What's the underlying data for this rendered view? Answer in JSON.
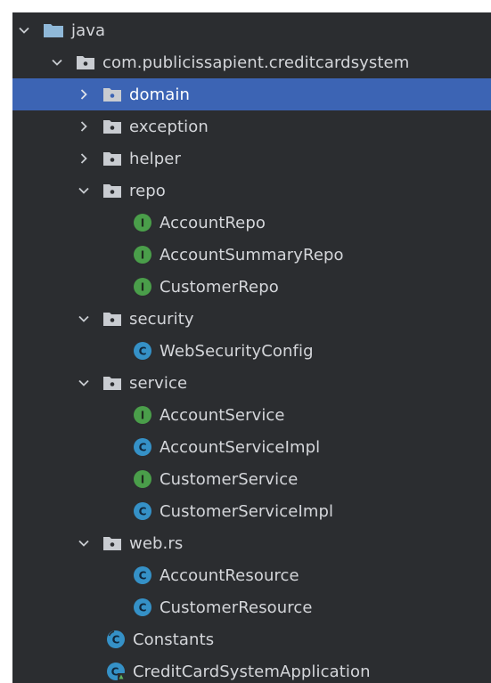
{
  "tree": {
    "root": {
      "label": "java",
      "expanded": true,
      "icon": "source-root-folder-icon"
    },
    "package": {
      "label": "com.publicissapient.creditcardsystem",
      "expanded": true,
      "icon": "package-folder-icon"
    },
    "folders": [
      {
        "key": "domain",
        "label": "domain",
        "expanded": false,
        "selected": true,
        "icon": "package-folder-icon",
        "children": []
      },
      {
        "key": "exception",
        "label": "exception",
        "expanded": false,
        "selected": false,
        "icon": "package-folder-icon",
        "children": []
      },
      {
        "key": "helper",
        "label": "helper",
        "expanded": false,
        "selected": false,
        "icon": "package-folder-icon",
        "children": []
      },
      {
        "key": "repo",
        "label": "repo",
        "expanded": true,
        "selected": false,
        "icon": "package-folder-icon",
        "children": [
          {
            "label": "AccountRepo",
            "kind": "interface",
            "icon": "interface-icon"
          },
          {
            "label": "AccountSummaryRepo",
            "kind": "interface",
            "icon": "interface-icon"
          },
          {
            "label": "CustomerRepo",
            "kind": "interface",
            "icon": "interface-icon"
          }
        ]
      },
      {
        "key": "security",
        "label": "security",
        "expanded": true,
        "selected": false,
        "icon": "package-folder-icon",
        "children": [
          {
            "label": "WebSecurityConfig",
            "kind": "class",
            "icon": "class-icon"
          }
        ]
      },
      {
        "key": "service",
        "label": "service",
        "expanded": true,
        "selected": false,
        "icon": "package-folder-icon",
        "children": [
          {
            "label": "AccountService",
            "kind": "interface",
            "icon": "interface-icon"
          },
          {
            "label": "AccountServiceImpl",
            "kind": "class",
            "icon": "class-icon"
          },
          {
            "label": "CustomerService",
            "kind": "interface",
            "icon": "interface-icon"
          },
          {
            "label": "CustomerServiceImpl",
            "kind": "class",
            "icon": "class-icon"
          }
        ]
      },
      {
        "key": "web-rs",
        "label": "web.rs",
        "expanded": true,
        "selected": false,
        "icon": "package-folder-icon",
        "children": [
          {
            "label": "AccountResource",
            "kind": "class",
            "icon": "class-icon"
          },
          {
            "label": "CustomerResource",
            "kind": "class",
            "icon": "class-icon"
          }
        ]
      }
    ],
    "files": [
      {
        "label": "Constants",
        "kind": "final-class",
        "icon": "final-class-icon"
      },
      {
        "label": "CreditCardSystemApplication",
        "kind": "spring-boot-class",
        "icon": "spring-boot-class-icon"
      }
    ]
  },
  "colors": {
    "background": "#2b2d30",
    "selected": "#3c64b4",
    "text": "#d4d6da",
    "interface": "#4a9e4a",
    "class": "#3591c7",
    "folder": "#8fb8d8",
    "package_folder": "#c9ccd1"
  }
}
